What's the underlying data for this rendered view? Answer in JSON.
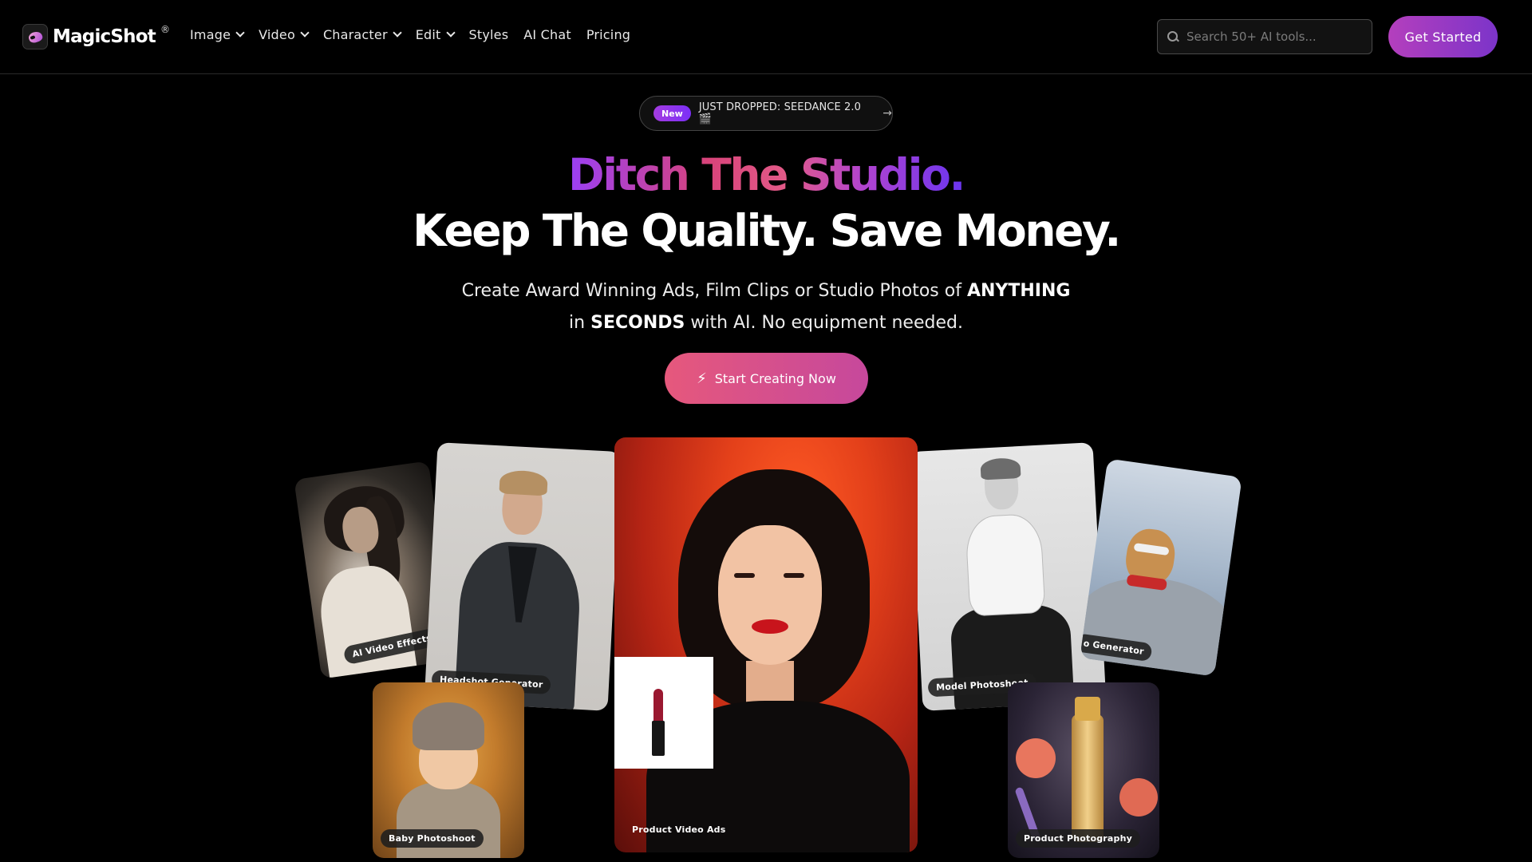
{
  "nav": {
    "logo_text": "MagicShot",
    "logo_reg": "®",
    "links": [
      {
        "label": "Image",
        "dropdown": true
      },
      {
        "label": "Video",
        "dropdown": true
      },
      {
        "label": "Character",
        "dropdown": true
      },
      {
        "label": "Edit",
        "dropdown": true
      },
      {
        "label": "Styles",
        "dropdown": false
      },
      {
        "label": "AI Chat",
        "dropdown": false
      },
      {
        "label": "Pricing",
        "dropdown": false
      }
    ],
    "search_placeholder": "Search 50+ AI tools...",
    "cta_label": "Get Started"
  },
  "hero": {
    "badge": "New",
    "announcement": "JUST DROPPED: SEEDANCE 2.0 🎬",
    "announcement_arrow": "→",
    "headline_1": "Ditch The Studio.",
    "headline_2": "Keep The Quality. Save Money.",
    "sub_line1_a": "Create Award Winning Ads, Film Clips or Studio Photos of ",
    "sub_line1_b": "ANYTHING",
    "sub_line2_a": "in ",
    "sub_line2_b": "SECONDS",
    "sub_line2_c": " with AI. No equipment needed.",
    "cta_label": "Start Creating Now",
    "cta_icon": "⚡"
  },
  "cards": {
    "video_effects": "AI Video Effects",
    "headshot": "Headshot Generator",
    "product_video": "Product Video Ads",
    "model_photoshoot": "Model Photoshoot",
    "video_generator": "o Generator",
    "baby_photoshoot": "Baby Photoshoot",
    "product_photography": "Product Photography"
  },
  "colors": {
    "accent_gradient_start": "#b43fbd",
    "accent_gradient_end": "#7c34c9",
    "cta_gradient_start": "#e6587c",
    "cta_gradient_end": "#c6489c"
  }
}
